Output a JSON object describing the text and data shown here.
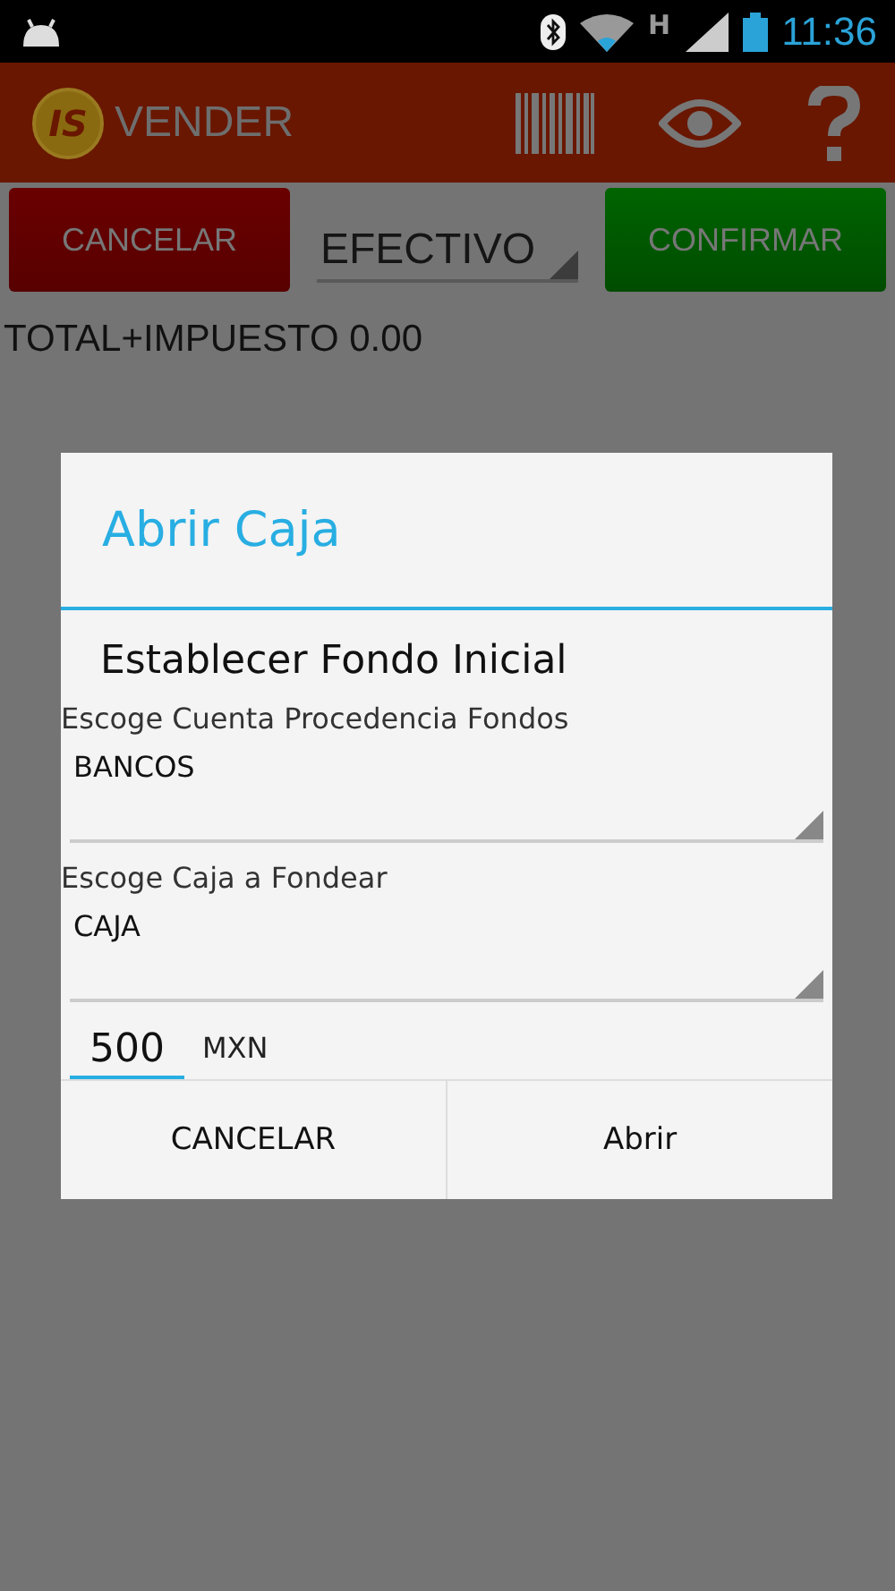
{
  "status_bar": {
    "network": "H",
    "time": "11:36"
  },
  "app_bar": {
    "logo_text": "IS",
    "title": "VENDER"
  },
  "actions": {
    "cancel": "CANCELAR",
    "payment": "EFECTIVO",
    "confirm": "CONFIRMAR"
  },
  "total": "TOTAL+IMPUESTO 0.00",
  "dialog": {
    "title": "Abrir Caja",
    "heading": "Establecer Fondo Inicial",
    "selects": [
      {
        "label": "Escoge Cuenta Procedencia Fondos",
        "value": "BANCOS"
      },
      {
        "label": "Escoge Caja a Fondear",
        "value": "CAJA"
      }
    ],
    "amount": {
      "value": "500",
      "unit": "MXN"
    },
    "buttons": [
      "CANCELAR",
      "Abrir"
    ]
  }
}
